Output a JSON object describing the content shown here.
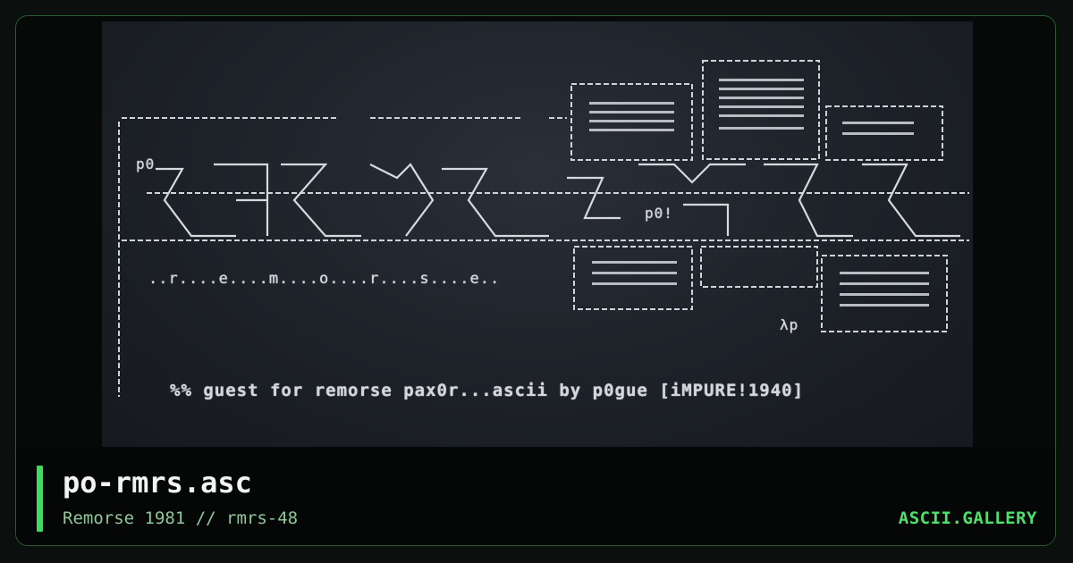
{
  "artwork": {
    "tag_top": "p0",
    "tag_mid": "p0!",
    "tag_bottom": "λp",
    "word": "..r....e....m....o....r....s....e..",
    "credit": "%% guest for remorse pax0r...ascii by p0gue [iMPURE!1940]"
  },
  "caption": {
    "title": "po-rmrs.asc",
    "subtitle": "Remorse 1981 // rmrs-48",
    "brand": "ASCII.GALLERY"
  },
  "colors": {
    "accent": "#3ddc5a",
    "brand": "#4ee06a",
    "subtitle": "#8fc79a",
    "art_text": "#d3d6dc",
    "art_bg": "#1d2128"
  }
}
